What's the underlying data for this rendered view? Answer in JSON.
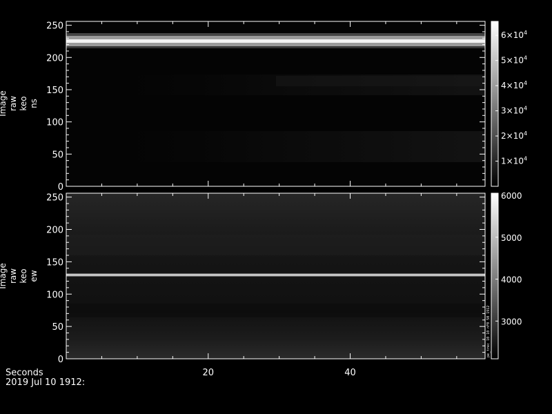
{
  "chart_data": [
    {
      "type": "heatmap",
      "ylabel_lines": [
        "Image",
        "raw",
        "keo",
        "ns"
      ],
      "xlim": [
        0,
        59
      ],
      "ylim": [
        0,
        256
      ],
      "x_ticks": [
        20,
        40
      ],
      "y_ticks": [
        0,
        50,
        100,
        150,
        200,
        250
      ],
      "y_tick_labels": [
        "0",
        "50",
        "100",
        "150",
        "200",
        "250"
      ],
      "colormap": "grayscale",
      "colorbar": {
        "range": [
          0,
          65535
        ],
        "ticks": [
          10000,
          20000,
          30000,
          40000,
          50000,
          60000
        ],
        "tick_mantissa": [
          "1",
          "2",
          "3",
          "4",
          "5",
          "6"
        ],
        "tick_base": "×10",
        "tick_exponent": "4"
      },
      "features": [
        {
          "rows": [
            218,
            232
          ],
          "level": 0.9,
          "description_visible": false
        },
        {
          "rows": [
            160,
            175
          ],
          "level": 0.12
        },
        {
          "rows": [
            85,
            120
          ],
          "level": 0.08
        },
        {
          "rows": [
            40,
            80
          ],
          "level": 0.1
        }
      ]
    },
    {
      "type": "heatmap",
      "ylabel_lines": [
        "Image",
        "raw",
        "keo",
        "ew"
      ],
      "xlim": [
        0,
        59
      ],
      "ylim": [
        0,
        256
      ],
      "x_ticks": [
        20,
        40
      ],
      "y_ticks": [
        0,
        50,
        100,
        150,
        200,
        250
      ],
      "y_tick_labels": [
        "0",
        "50",
        "100",
        "150",
        "200",
        "250"
      ],
      "colormap": "grayscale",
      "colorbar": {
        "range": [
          2100,
          6050
        ],
        "ticks": [
          3000,
          4000,
          5000,
          6000
        ],
        "tick_labels": [
          "3000",
          "4000",
          "5000",
          "6000"
        ],
        "side_text": "pe_trec 10 10 nF0 50 1912"
      },
      "features": [
        {
          "rows": [
            128,
            130
          ],
          "level": 0.95
        }
      ]
    }
  ],
  "x_tick_labels": [
    "20",
    "40"
  ],
  "footer": {
    "line1": "Seconds",
    "line2": "2019 Jul 10 1912:"
  }
}
